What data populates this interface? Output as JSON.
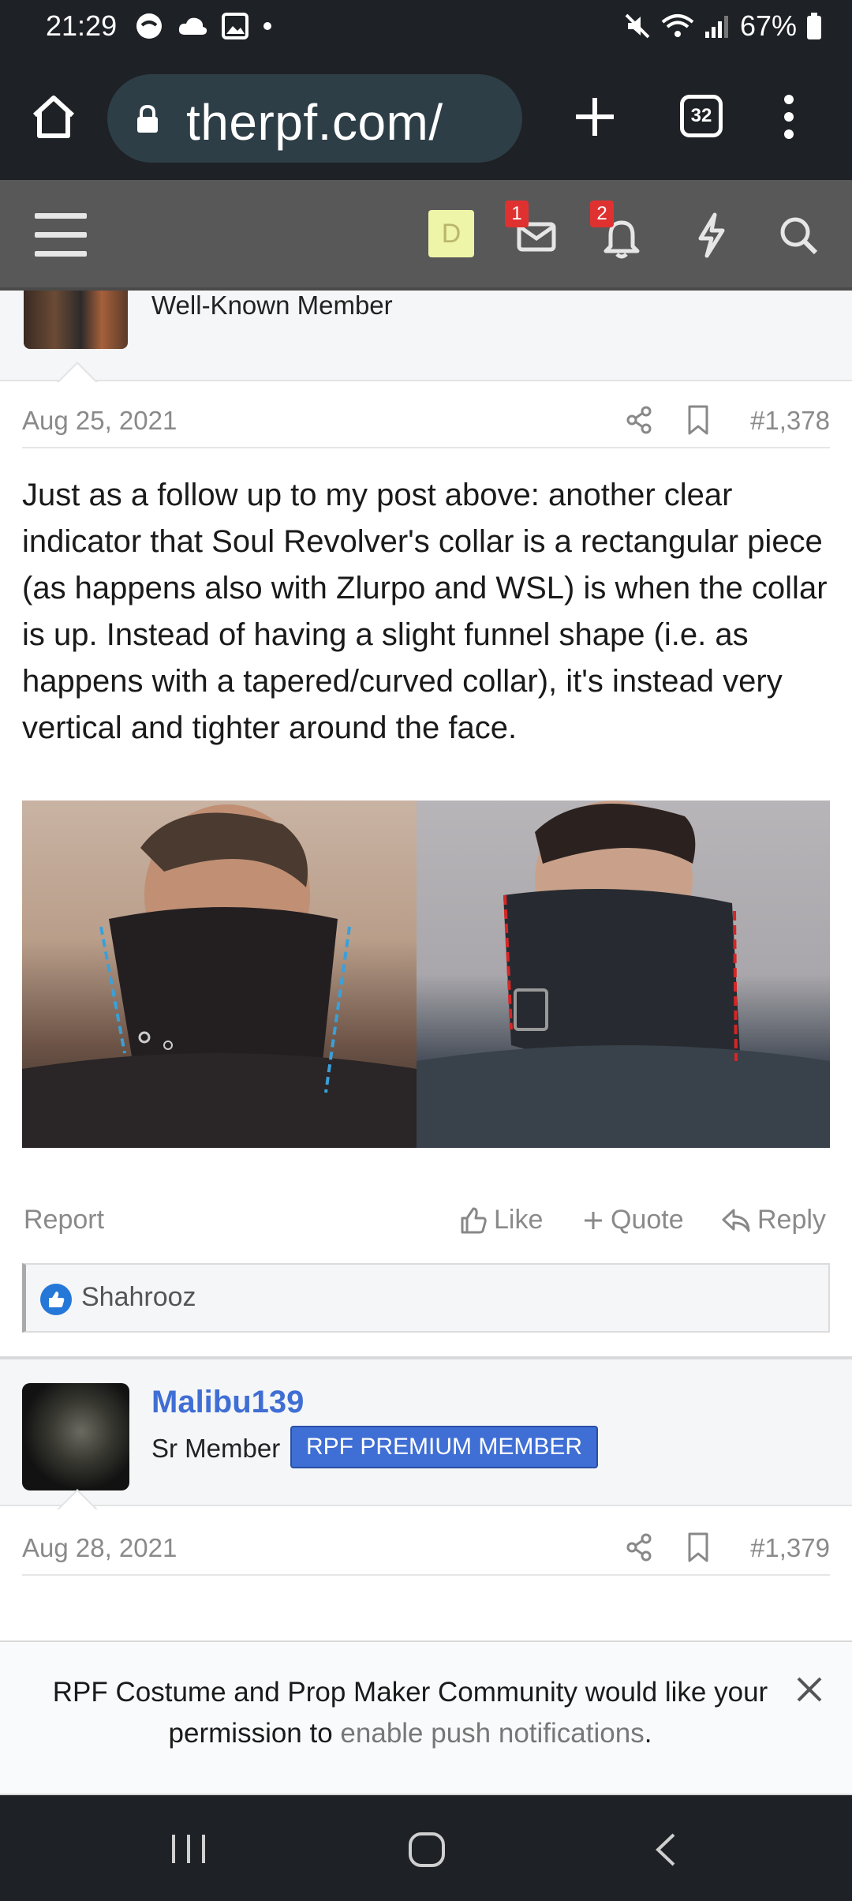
{
  "status_bar": {
    "time": "21:29",
    "battery": "67%"
  },
  "browser": {
    "url": "therpf.com/",
    "tab_count": "32"
  },
  "site_nav": {
    "user_initial": "D",
    "inbox_badge": "1",
    "alerts_badge": "2"
  },
  "post1": {
    "author_role": "Well-Known Member",
    "date": "Aug 25, 2021",
    "post_number": "#1,378",
    "body": "Just as a follow up to my post above: another clear indicator that Soul Revolver's collar is a rectangular piece (as happens also with Zlurpo and WSL) is when the collar is up. Instead of having a slight funnel shape (i.e. as happens with a tapered/curved collar), it's instead very vertical and tighter around the face.",
    "actions": {
      "report": "Report",
      "like": "Like",
      "quote": "Quote",
      "reply": "Reply"
    },
    "reactions": "Shahrooz"
  },
  "post2": {
    "username": "Malibu139",
    "rank": "Sr Member",
    "badge": "RPF PREMIUM MEMBER",
    "date": "Aug 28, 2021",
    "post_number": "#1,379"
  },
  "notification": {
    "text_before": "RPF Costume and Prop Maker Community would like your permission to ",
    "link": "enable push notifications",
    "text_after": "."
  },
  "colors": {
    "username_blue": "#3f6ed4",
    "badge_red": "#e03131",
    "guide_line_blue": "#3aa0d8",
    "guide_line_red": "#d62626"
  }
}
